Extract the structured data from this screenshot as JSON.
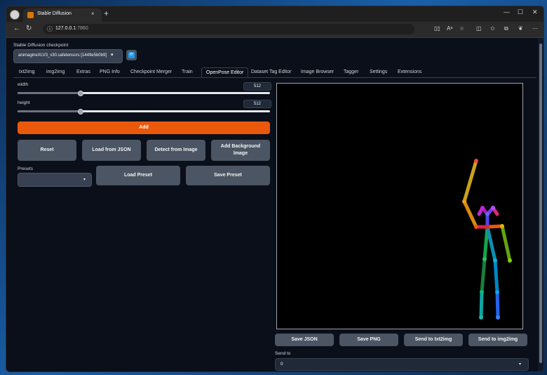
{
  "browser": {
    "tab_title": "Stable Diffusion",
    "tab_close": "×",
    "new_tab": "+",
    "url_host": "127.0.0.1",
    "url_port": ":7860",
    "window_controls": [
      "—",
      "☐",
      "✕"
    ],
    "toolbar_icons": [
      "read-aloud-icon",
      "text-size-icon",
      "favorite-icon",
      "split-screen-icon",
      "favorites-icon",
      "collections-icon",
      "copilot-icon",
      "more-icon"
    ]
  },
  "app": {
    "checkpoint_label": "Stable Diffusion checkpoint",
    "checkpoint_value": "animagineXLV3_v30.safetensors [1449e5b0b9]",
    "tabs": [
      "txt2img",
      "img2img",
      "Extras",
      "PNG Info",
      "Checkpoint Merger",
      "Train",
      "OpenPose Editor",
      "Dataset Tag Editor",
      "Image Browser",
      "Tagger",
      "Settings",
      "Extensions"
    ],
    "active_tab": "OpenPose Editor",
    "width": {
      "label": "width",
      "value": "512",
      "level": 0.25
    },
    "height": {
      "label": "height",
      "value": "512",
      "level": 0.25
    },
    "buttons": {
      "add": "Add",
      "reset": "Reset",
      "load_json": "Load from JSON",
      "detect": "Detect from Image",
      "add_bg_line1": "Add Background",
      "add_bg_line2": "Image",
      "load_preset": "Load Preset",
      "save_preset": "Save Preset",
      "save_json": "Save JSON",
      "save_png": "Save PNG",
      "send_txt2img": "Send to txt2img",
      "send_img2img": "Send to img2img"
    },
    "presets_label": "Presets",
    "send_to_label": "Send to",
    "send_to_value": "0"
  },
  "colors": {
    "accent": "#ea580c",
    "canvas_bg": "#000000",
    "bg": "#0b0f19"
  }
}
